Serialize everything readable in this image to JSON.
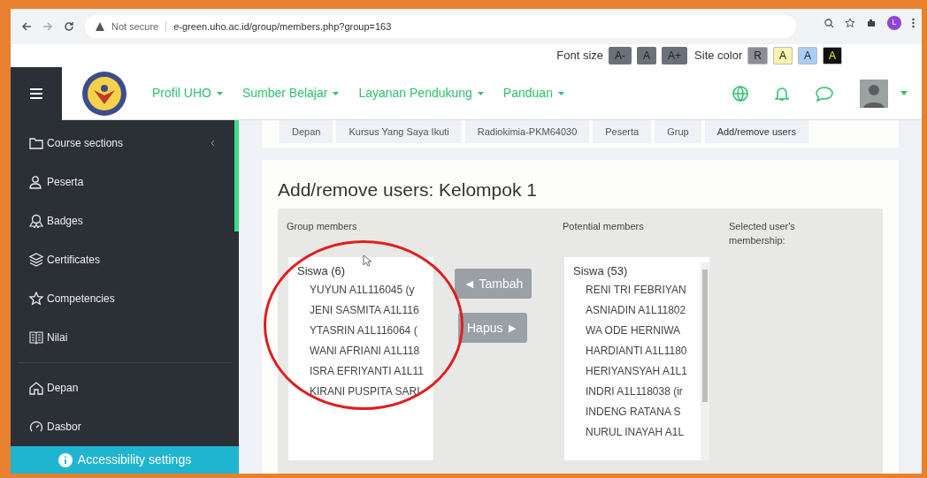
{
  "browser": {
    "security": "Not secure",
    "url": "e-green.uho.ac.id/group/members.php?group=163",
    "profile_initial": "L"
  },
  "accessibility_bar": {
    "font_size_label": "Font size",
    "font_buttons": [
      "A-",
      "A",
      "A+"
    ],
    "site_color_label": "Site color",
    "color_buttons": [
      {
        "label": "R",
        "color": "#8a8f96"
      },
      {
        "label": "A",
        "color": "#fdf3b0"
      },
      {
        "label": "A",
        "color": "#a9cdf5"
      },
      {
        "label": "A",
        "color": "#111111"
      }
    ]
  },
  "navbar": {
    "menus": [
      "Profil UHO",
      "Sumber Belajar",
      "Layanan Pendukung",
      "Panduan"
    ]
  },
  "sidebar": {
    "items": [
      {
        "label": "Course sections",
        "kind": "folder"
      },
      {
        "label": "Peserta",
        "kind": "users"
      },
      {
        "label": "Badges",
        "kind": "badge"
      },
      {
        "label": "Certificates",
        "kind": "layers"
      },
      {
        "label": "Competencies",
        "kind": "star"
      },
      {
        "label": "Nilai",
        "kind": "book"
      }
    ],
    "bottom_items": [
      {
        "label": "Depan",
        "kind": "home"
      },
      {
        "label": "Dasbor",
        "kind": "gauge"
      }
    ],
    "accessibility_button": "Accessibility settings"
  },
  "breadcrumb": [
    "Depan",
    "Kursus Yang Saya Ikuti",
    "Radiokimia-PKM64030",
    "Peserta",
    "Grup",
    "Add/remove users"
  ],
  "title": "Add/remove users: Kelompok 1",
  "group_members": {
    "label": "Group members",
    "group": "Siswa (6)",
    "members": [
      "YUYUN A1L116045 (y",
      "JENI SASMITA A1L116",
      "YTASRIN A1L116064 (",
      "WANI AFRIANI A1L118",
      "ISRA EFRIYANTI A1L11",
      "KIRANI PUSPITA SARI"
    ]
  },
  "actions": {
    "add": "◄ Tambah",
    "remove": "Hapus ►"
  },
  "potential_members": {
    "label": "Potential members",
    "group": "Siswa (53)",
    "members": [
      "RENI TRI FEBRIYAN",
      "ASNIADIN A1L11802",
      "WA ODE HERNIWA",
      "HARDIANTI A1L1180",
      "HERIYANSYAH A1L1",
      "INDRI A1L118038 (ir",
      "INDENG RATANA S",
      "NURUL INAYAH A1L"
    ]
  },
  "selected_membership": {
    "label": "Selected user's membership:"
  }
}
